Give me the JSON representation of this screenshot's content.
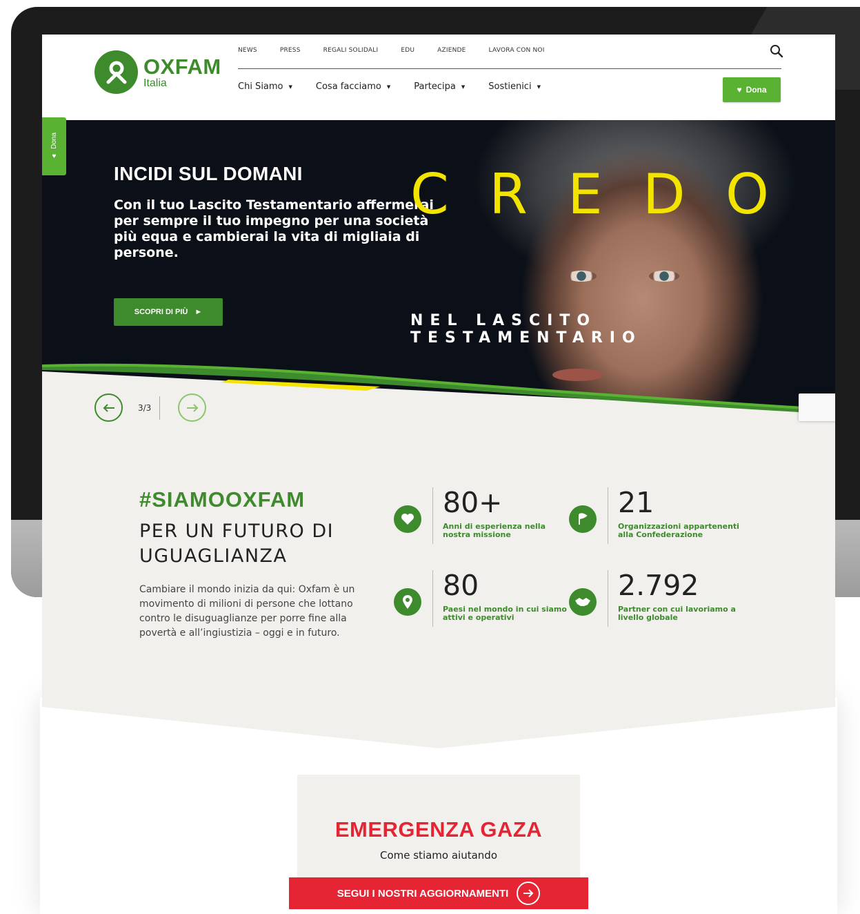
{
  "colors": {
    "brand_green": "#3d8b2d",
    "light_green": "#5ab233",
    "credo_yellow": "#f3e400",
    "emergency_red": "#e52534"
  },
  "logo": {
    "name": "OXFAM",
    "sub": "Italia"
  },
  "top_nav": [
    "NEWS",
    "PRESS",
    "REGALI SOLIDALI",
    "EDU",
    "AZIENDE",
    "LAVORA CON NOI"
  ],
  "main_nav": [
    "Chi Siamo",
    "Cosa facciamo",
    "Partecipa",
    "Sostienici"
  ],
  "header": {
    "dona_label": "Dona",
    "search_icon": "search-icon"
  },
  "side_tab": {
    "label": "Dona"
  },
  "hero": {
    "title": "INCIDI SUL DOMANI",
    "text": "Con il tuo Lascito Testamentario affermerai per sempre il tuo impegno per una società più equa e cambierai la vita di migliaia di persone.",
    "cta": "SCOPRI DI PIÙ",
    "credo": [
      "C",
      "R",
      "E",
      "D",
      "O"
    ],
    "credo_sub": "NEL LASCITO TESTAMENTARIO"
  },
  "slider": {
    "counter": "3/3"
  },
  "siamo": {
    "title": "#SIAMOOXFAM",
    "subtitle": "PER UN FUTURO DI UGUAGLIANZA",
    "body": "Cambiare il mondo inizia da qui: Oxfam è un movimento di milioni di persone che lottano contro le disuguaglianze per porre fine alla povertà e all’ingiustizia – oggi e in futuro."
  },
  "stats": [
    {
      "number": "80+",
      "label": "Anni di esperienza nella nostra missione",
      "icon": "heart-icon"
    },
    {
      "number": "21",
      "label": "Organizzazioni appartenenti alla Confederazione",
      "icon": "flag-icon"
    },
    {
      "number": "80",
      "label": "Paesi nel mondo in cui siamo attivi e operativi",
      "icon": "location-pin-icon"
    },
    {
      "number": "2.792",
      "label": "Partner con cui lavoriamo a livello globale",
      "icon": "handshake-icon"
    }
  ],
  "emergency": {
    "title": "EMERGENZA GAZA",
    "subtitle": "Come stiamo aiutando",
    "button": "SEGUI I NOSTRI AGGIORNAMENTI"
  }
}
